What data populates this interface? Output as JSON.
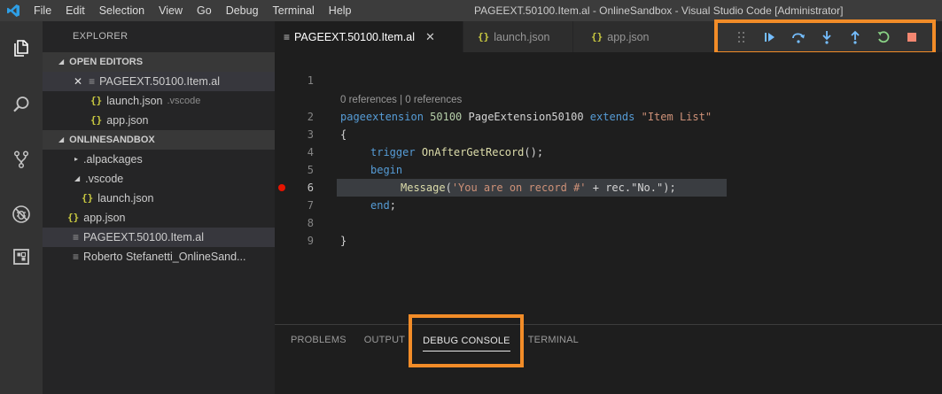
{
  "titlebar": {
    "menu": [
      "File",
      "Edit",
      "Selection",
      "View",
      "Go",
      "Debug",
      "Terminal",
      "Help"
    ],
    "window_title": "PAGEEXT.50100.Item.al - OnlineSandbox - Visual Studio Code [Administrator]"
  },
  "activity_icons": [
    "explorer-icon",
    "search-icon",
    "source-control-icon",
    "debug-icon",
    "extensions-icon"
  ],
  "sidebar": {
    "title": "EXPLORER",
    "open_editors": {
      "header": "OPEN EDITORS",
      "items": [
        {
          "label": "PAGEEXT.50100.Item.al",
          "hint": ""
        },
        {
          "label": "launch.json",
          "hint": ".vscode"
        },
        {
          "label": "app.json",
          "hint": ""
        }
      ]
    },
    "workspace": {
      "header": "ONLINESANDBOX",
      "items": [
        {
          "label": ".alpackages"
        },
        {
          "label": ".vscode"
        },
        {
          "label": "launch.json"
        },
        {
          "label": "app.json"
        },
        {
          "label": "PAGEEXT.50100.Item.al"
        },
        {
          "label": "Roberto Stefanetti_OnlineSand..."
        }
      ]
    }
  },
  "tabs": [
    {
      "label": "PAGEEXT.50100.Item.al",
      "active": true
    },
    {
      "label": "launch.json",
      "active": false
    },
    {
      "label": "app.json",
      "active": false
    }
  ],
  "debug_toolbar": [
    "drag-handle-icon",
    "continue-icon",
    "step-over-icon",
    "step-into-icon",
    "step-out-icon",
    "restart-icon",
    "stop-icon"
  ],
  "editor": {
    "code_lens": "0 references | 0 references",
    "line_numbers": [
      "1",
      "2",
      "3",
      "4",
      "5",
      "6",
      "7",
      "8",
      "9"
    ],
    "line2": {
      "kw": "pageextension",
      "num": "50100",
      "name": "PageExtension50100",
      "kw2": "extends",
      "target": "\"Item List\""
    },
    "line3": "{",
    "line4": {
      "kw": "trigger",
      "fn": "OnAfterGetRecord",
      "rest": "();"
    },
    "line5": "begin",
    "line6": {
      "fn": "Message",
      "open": "(",
      "str": "'You are on record #'",
      "rest": " + rec.\"No.\");"
    },
    "line7": {
      "kw": "end",
      "rest": ";"
    },
    "line9": "}",
    "breakpoint_line": "6"
  },
  "panel": {
    "tabs": [
      "PROBLEMS",
      "OUTPUT",
      "DEBUG CONSOLE",
      "TERMINAL"
    ],
    "active": "DEBUG CONSOLE"
  },
  "colors": {
    "highlight": "#f28c28",
    "breakpoint": "#e51400"
  }
}
